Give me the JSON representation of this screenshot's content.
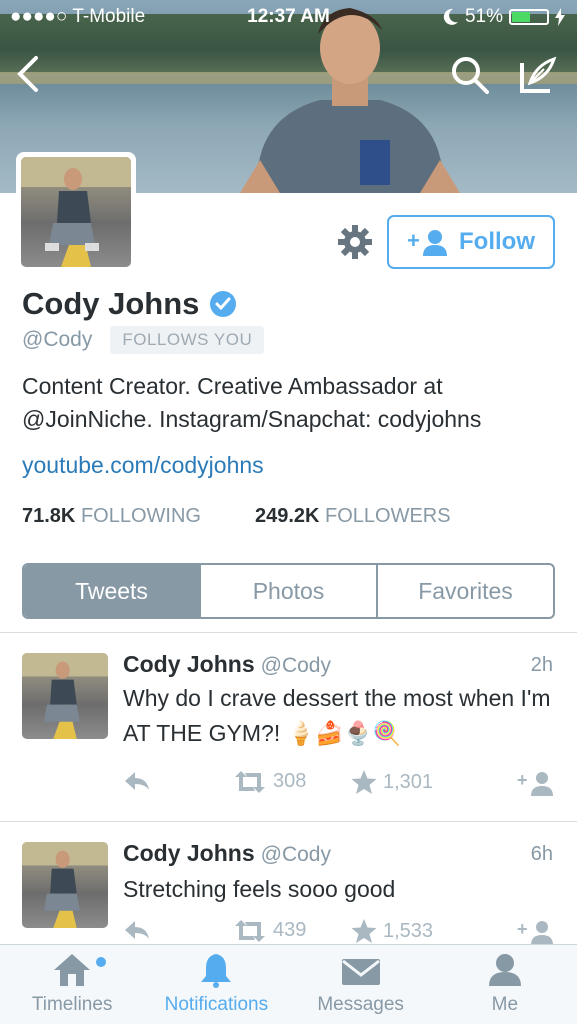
{
  "status_bar": {
    "carrier": "●●●●○ T-Mobile",
    "time": "12:37 AM",
    "battery": "51%"
  },
  "profile": {
    "name": "Cody Johns",
    "handle": "@Cody",
    "follows_you": "FOLLOWS YOU",
    "follow_label": "Follow",
    "bio": "Content Creator. Creative Ambassador at @JoinNiche. Instagram/Snapchat: codyjohns",
    "link": "youtube.com/codyjohns",
    "following_count": "71.8K",
    "following_label": "FOLLOWING",
    "followers_count": "249.2K",
    "followers_label": "FOLLOWERS"
  },
  "tabs": [
    {
      "label": "Tweets",
      "active": true
    },
    {
      "label": "Photos",
      "active": false
    },
    {
      "label": "Favorites",
      "active": false
    }
  ],
  "tweets": [
    {
      "name": "Cody Johns",
      "handle": "@Cody",
      "time": "2h",
      "text": "Why do I crave dessert the most when I'm AT THE GYM?! 🍦🍰🍨🍭",
      "retweets": "308",
      "favorites": "1,301"
    },
    {
      "name": "Cody Johns",
      "handle": "@Cody",
      "time": "6h",
      "text": "Stretching feels sooo good",
      "retweets": "439",
      "favorites": "1,533"
    }
  ],
  "tabbar": [
    {
      "label": "Timelines",
      "icon": "home-icon",
      "active": false
    },
    {
      "label": "Notifications",
      "icon": "bell-icon",
      "active": true
    },
    {
      "label": "Messages",
      "icon": "envelope-icon",
      "active": false
    },
    {
      "label": "Me",
      "icon": "person-icon",
      "active": false
    }
  ],
  "colors": {
    "accent": "#55acee",
    "link": "#2b7bb9",
    "muted": "#8899a6",
    "tab_active_bg": "#8899a6"
  }
}
